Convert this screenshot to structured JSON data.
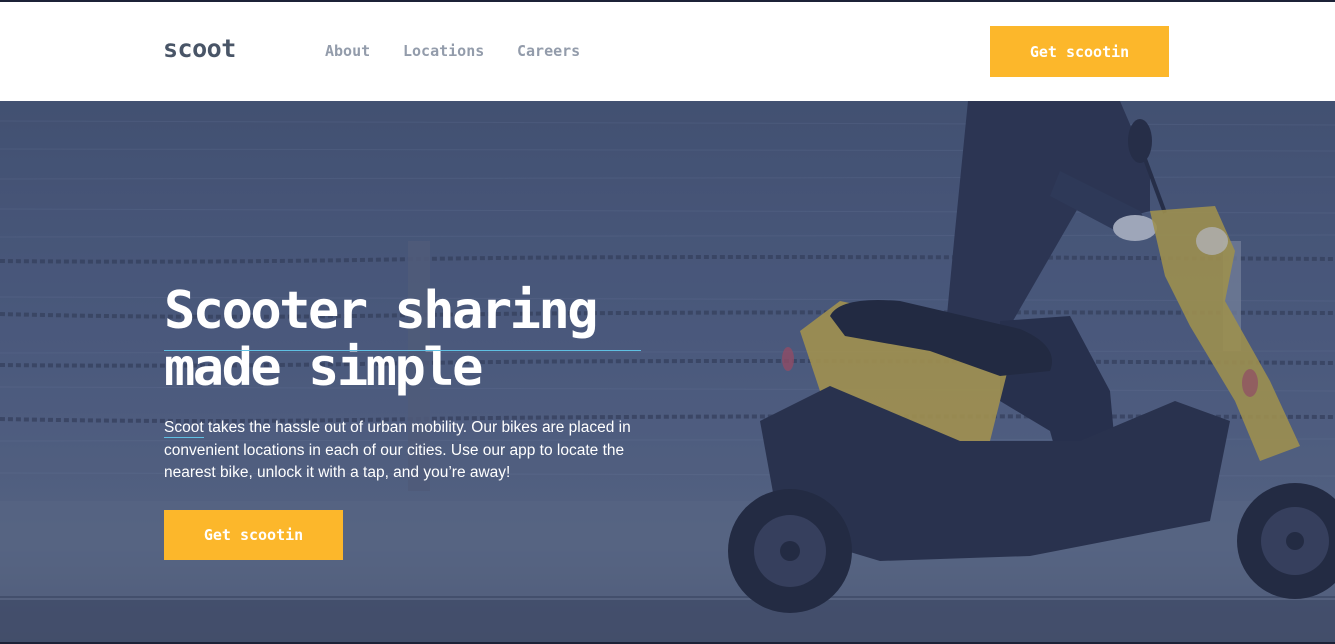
{
  "header": {
    "logo": "scoot",
    "nav": [
      {
        "label": "About"
      },
      {
        "label": "Locations"
      },
      {
        "label": "Careers"
      }
    ],
    "cta_label": "Get scootin"
  },
  "hero": {
    "title_line1": "Scooter sharing",
    "title_line2": "made simple",
    "brand_word": "Scoot",
    "body": " takes the hassle out of urban mobility. Our bikes are placed in convenient locations in each of our cities. Use our app to locate the nearest bike, unlock it with a tap, and you’re away!",
    "cta_label": "Get scootin"
  },
  "colors": {
    "accent": "#fcb72b",
    "navy": "#1c2237",
    "nav_text": "#939cab",
    "underline": "#5fc0e3"
  },
  "icons": {
    "hero_image": "scooter-rider-seafront-photo"
  }
}
